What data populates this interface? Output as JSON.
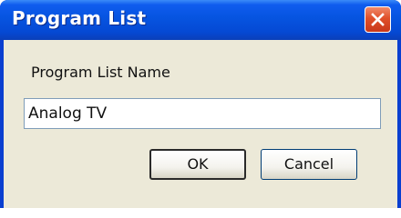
{
  "dialog": {
    "title": "Program List",
    "field_label": "Program List Name",
    "field_value": "Analog TV",
    "ok_label": "OK",
    "cancel_label": "Cancel"
  },
  "icons": {
    "close": "close-icon"
  },
  "colors": {
    "titlebar": "#0654e0",
    "close_button": "#e0502a",
    "client_background": "#ece9d8"
  }
}
